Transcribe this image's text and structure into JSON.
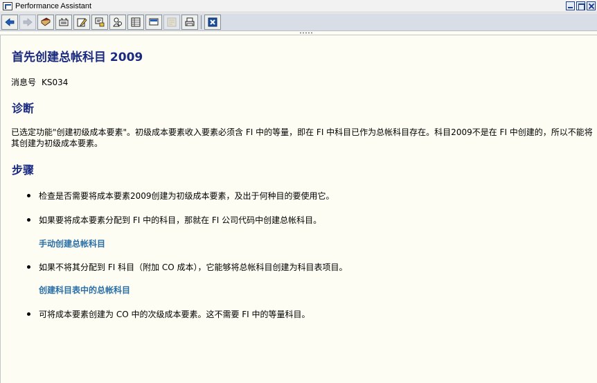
{
  "window": {
    "title": "Performance Assistant"
  },
  "toolbar": {
    "buttons": [
      {
        "icon": "arrow-left-icon"
      },
      {
        "icon": "arrow-right-icon"
      },
      {
        "icon": "book-icon"
      },
      {
        "icon": "technical-info-icon"
      },
      {
        "icon": "edit-icon"
      },
      {
        "icon": "tags-icon"
      },
      {
        "icon": "person-search-icon"
      },
      {
        "icon": "table-icon"
      },
      {
        "icon": "screen-icon"
      },
      {
        "icon": "note-disabled-icon"
      },
      {
        "icon": "print-icon"
      },
      {
        "icon": "close-window-icon"
      }
    ]
  },
  "doc": {
    "title": "首先创建总帐科目 2009",
    "message_label": "消息号",
    "message_no": "KS034",
    "diagnosis_heading": "诊断",
    "diagnosis_text": "已选定功能\"创建初级成本要素\"。初级成本要素收入要素必须含 FI 中的等量，即在 FI 中科目已作为总帐科目存在。科目2009不是在 FI 中创建的，所以不能将其创建为初级成本要素。",
    "steps_heading": "步骤",
    "steps": [
      "检查是否需要将成本要素2009创建为初级成本要素，及出于何种目的要使用它。",
      "如果要将成本要素分配到 FI 中的科目，那就在 FI 公司代码中创建总帐科目。",
      "如果不将其分配到 FI 科目（附加 CO 成本），它能够将总帐科目创建为科目表项目。",
      "可将成本要素创建为 CO 中的次级成本要素。这不需要 FI 中的等量科目。"
    ],
    "links": [
      "手动创建总帐科目",
      "创建科目表中的总帐科目"
    ]
  },
  "colors": {
    "heading": "#1a2a80",
    "link": "#2a6fa8",
    "background": "#fdfdf3"
  }
}
